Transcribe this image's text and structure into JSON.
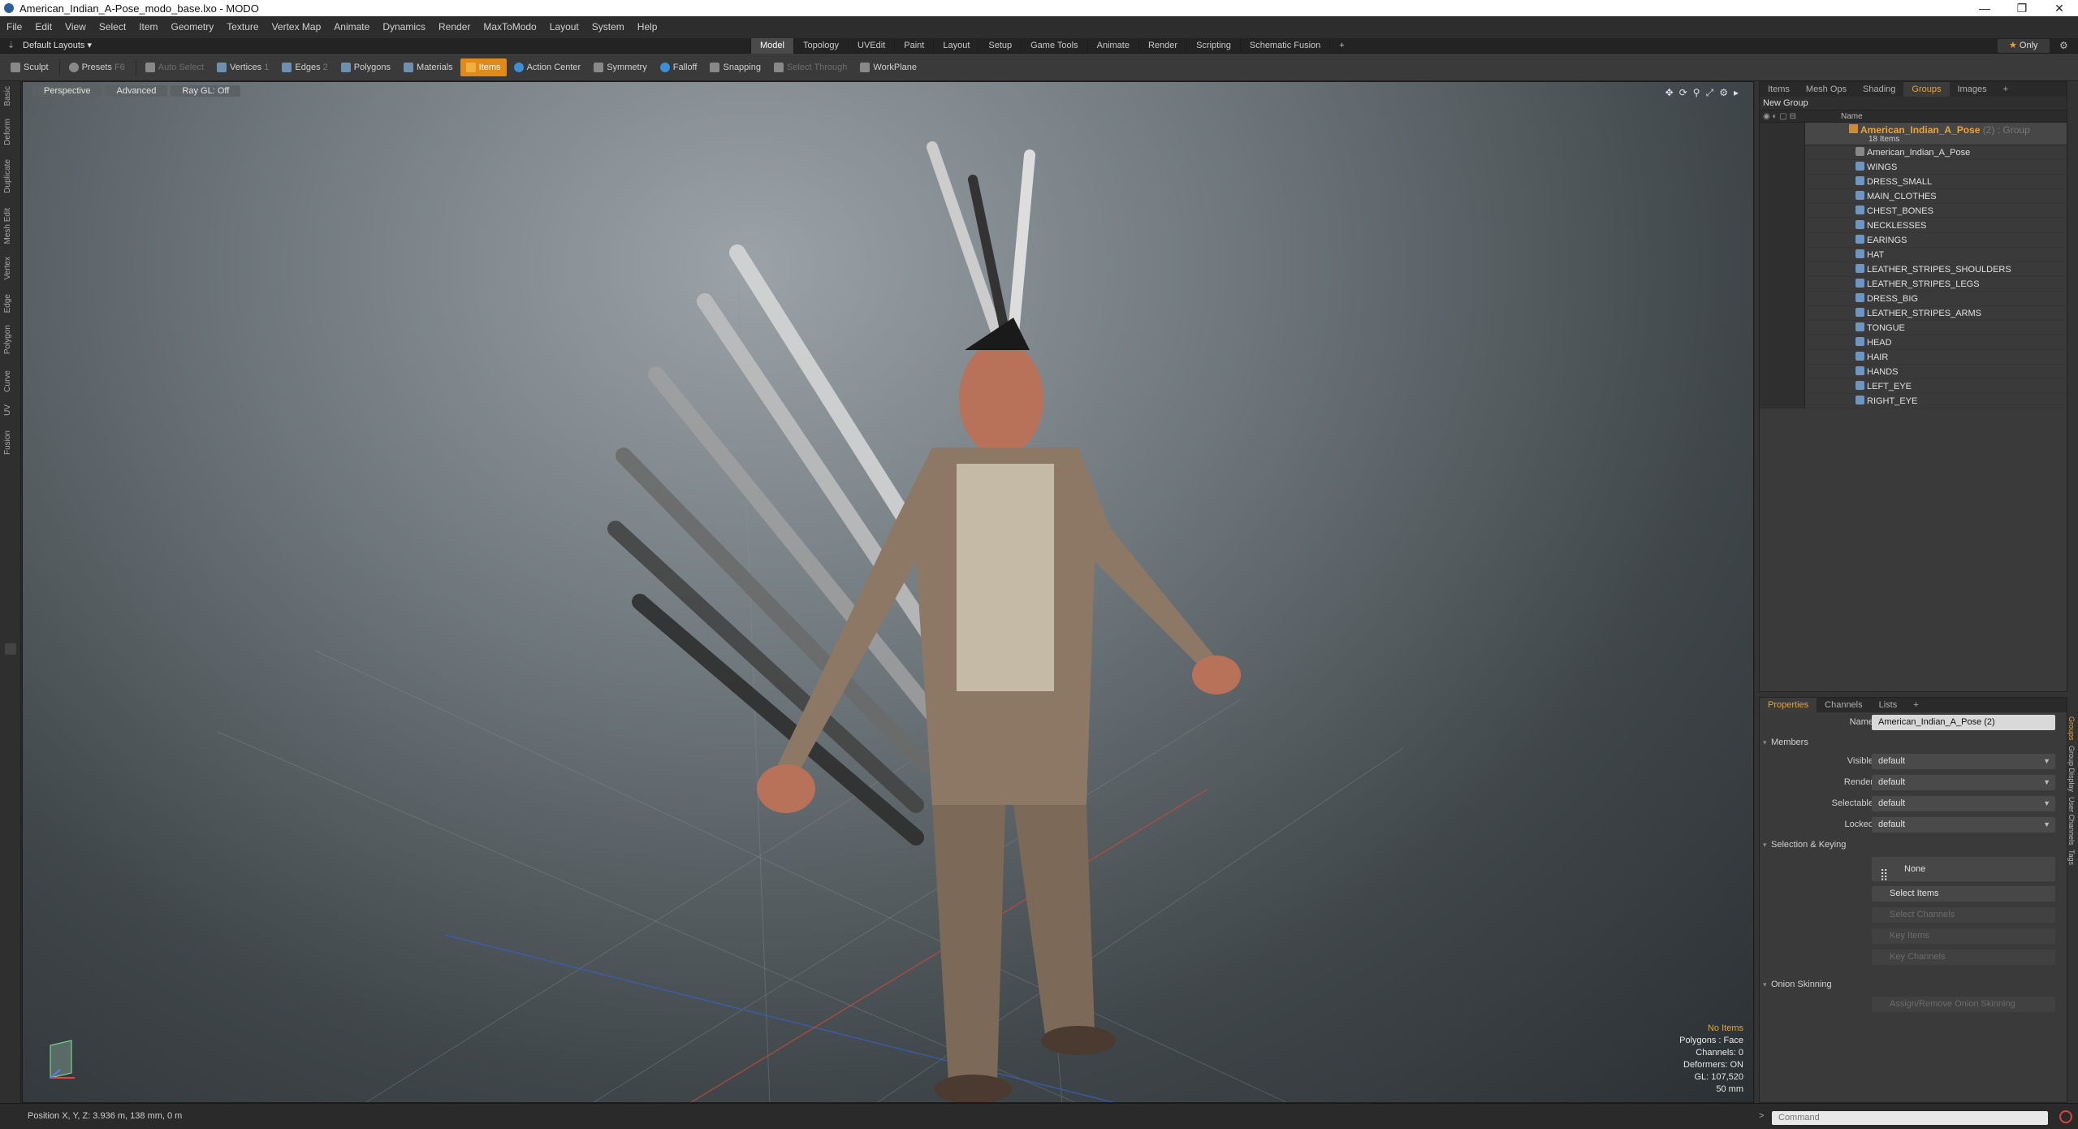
{
  "window": {
    "title": "American_Indian_A-Pose_modo_base.lxo - MODO",
    "controls": [
      "—",
      "❐",
      "✕"
    ]
  },
  "menu": [
    "File",
    "Edit",
    "View",
    "Select",
    "Item",
    "Geometry",
    "Texture",
    "Vertex Map",
    "Animate",
    "Dynamics",
    "Render",
    "MaxToModo",
    "Layout",
    "System",
    "Help"
  ],
  "layout": {
    "selector": "Default Layouts ▾",
    "tabs": [
      "Model",
      "Topology",
      "UVEdit",
      "Paint",
      "Layout",
      "Setup",
      "Game Tools",
      "Animate",
      "Render",
      "Scripting",
      "Schematic Fusion",
      "+"
    ],
    "active_tab": "Model",
    "only_label": "Only"
  },
  "toolbar": {
    "sculpt": "Sculpt",
    "presets": "Presets",
    "presets_key": "F6",
    "auto_select": "Auto Select",
    "vertices": "Vertices",
    "vertices_num": "1",
    "edges": "Edges",
    "edges_num": "2",
    "polygons": "Polygons",
    "materials": "Materials",
    "items": "Items",
    "action_center": "Action Center",
    "symmetry": "Symmetry",
    "falloff": "Falloff",
    "snapping": "Snapping",
    "select_through": "Select Through",
    "workplane": "WorkPlane"
  },
  "left_tabs": [
    "Basic",
    "Deform",
    "Duplicate",
    "Mesh Edit",
    "Vertex",
    "Edge",
    "Polygon",
    "Curve",
    "UV",
    "Fusion"
  ],
  "viewport": {
    "view": "Perspective",
    "shading": "Advanced",
    "raygl": "Ray GL: Off",
    "info": {
      "selection": "No Items",
      "polygons": "Polygons : Face",
      "channels": "Channels: 0",
      "deformers": "Deformers: ON",
      "gl": "GL: 107,520",
      "scale": "50 mm"
    },
    "colors": {
      "accent": "#e8a33a"
    }
  },
  "groups_panel": {
    "tabs": [
      "Items",
      "Mesh Ops",
      "Shading",
      "Groups",
      "Images",
      "+"
    ],
    "active_tab": "Groups",
    "new_group": "New Group",
    "col_name": "Name",
    "group": {
      "name": "American_Indian_A_Pose",
      "suffix": "(2) : Group",
      "count": "18 Items"
    },
    "items": [
      "American_Indian_A_Pose",
      "WINGS",
      "DRESS_SMALL",
      "MAIN_CLOTHES",
      "CHEST_BONES",
      "NECKLESSES",
      "EARINGS",
      "HAT",
      "LEATHER_STRIPES_SHOULDERS",
      "LEATHER_STRIPES_LEGS",
      "DRESS_BIG",
      "LEATHER_STRIPES_ARMS",
      "TONGUE",
      "HEAD",
      "HAIR",
      "HANDS",
      "LEFT_EYE",
      "RIGHT_EYE"
    ]
  },
  "properties": {
    "tabs": [
      "Properties",
      "Channels",
      "Lists",
      "+"
    ],
    "active_tab": "Properties",
    "name_label": "Name",
    "name_value": "American_Indian_A_Pose (2)",
    "members": "Members",
    "visible_label": "Visible",
    "visible_value": "default",
    "render_label": "Render",
    "render_value": "default",
    "selectable_label": "Selectable",
    "selectable_value": "default",
    "locked_label": "Locked",
    "locked_value": "default",
    "selection_keying": "Selection & Keying",
    "none_btn": "None",
    "select_items": "Select Items",
    "select_channels": "Select Channels",
    "key_items": "Key Items",
    "key_channels": "Key Channels",
    "onion": "Onion Skinning",
    "assign_onion": "Assign/Remove Onion Skinning",
    "side_tabs": [
      "Groups",
      "Group Display",
      "User Channels",
      "Tags"
    ]
  },
  "status": {
    "position": "Position X, Y, Z:   3.936 m, 138 mm, 0 m",
    "command_placeholder": "Command"
  }
}
